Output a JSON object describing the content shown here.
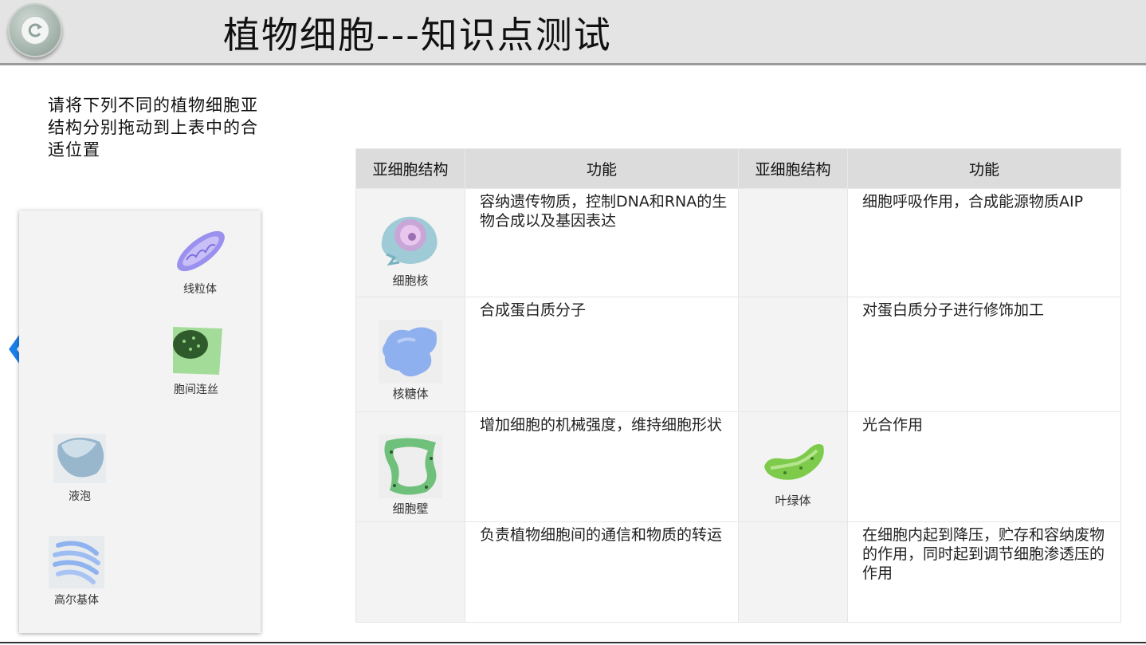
{
  "header": {
    "title": "植物细胞---知识点测试"
  },
  "instruction": "请将下列不同的植物细胞亚结构分别拖动到上表中的合适位置",
  "palette": {
    "items": [
      {
        "label": "线粒体",
        "icon": "mitochondrion-icon"
      },
      {
        "label": "胞间连丝",
        "icon": "plasmodesmata-icon"
      },
      {
        "label": "液泡",
        "icon": "vacuole-icon"
      },
      {
        "label": "高尔基体",
        "icon": "golgi-icon"
      }
    ]
  },
  "table": {
    "headers": [
      "亚细胞结构",
      "功能",
      "亚细胞结构",
      "功能"
    ],
    "rows": [
      {
        "left_piece": "细胞核",
        "left_function": "容纳遗传物质，控制DNA和RNA的生物合成以及基因表达",
        "right_piece": "",
        "right_function": "细胞呼吸作用，合成能源物质AIP"
      },
      {
        "left_piece": "核糖体",
        "left_function": "合成蛋白质分子",
        "right_piece": "",
        "right_function": "对蛋白质分子进行修饰加工"
      },
      {
        "left_piece": "细胞壁",
        "left_function": "增加细胞的机械强度，维持细胞形状",
        "right_piece": "叶绿体",
        "right_function": "光合作用"
      },
      {
        "left_piece": "",
        "left_function": "负责植物细胞间的通信和物质的转运",
        "right_piece": "",
        "right_function": "在细胞内起到降压，贮存和容纳废物的作用，同时起到调节细胞渗透压的作用"
      }
    ]
  },
  "colors": {
    "arrow": "#1a7fe8",
    "header_bg": "#e4e4e4",
    "table_header_bg": "#dcdcdc"
  }
}
